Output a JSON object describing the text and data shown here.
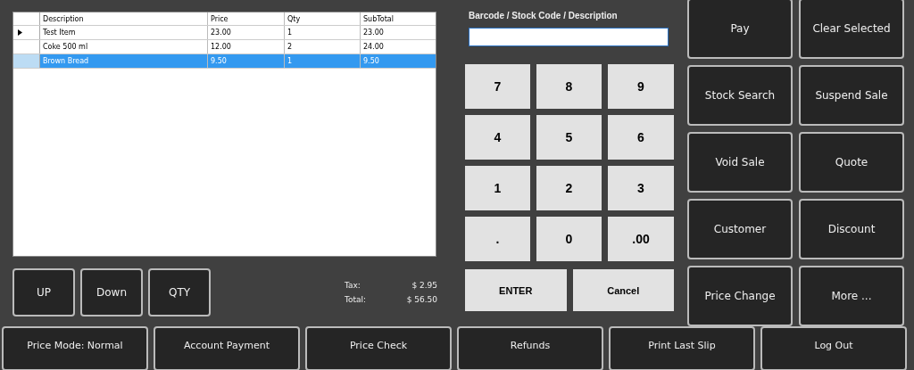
{
  "grid": {
    "columns": [
      "Description",
      "Price",
      "Qty",
      "SubTotal"
    ],
    "rows": [
      {
        "current": true,
        "selected": false,
        "cells": [
          "Test Item",
          "23.00",
          "1",
          "23.00"
        ]
      },
      {
        "current": false,
        "selected": false,
        "cells": [
          "Coke 500 ml",
          "12.00",
          "2",
          "24.00"
        ]
      },
      {
        "current": false,
        "selected": true,
        "cells": [
          "Brown Bread",
          "9.50",
          "1",
          "9.50"
        ]
      }
    ]
  },
  "nav_buttons": [
    "UP",
    "Down",
    "QTY"
  ],
  "totals": [
    {
      "label": "Tax:",
      "value": "$ 2.95"
    },
    {
      "label": "Total:",
      "value": "$ 56.50"
    }
  ],
  "search": {
    "label": "Barcode / Stock Code / Description"
  },
  "keypad": [
    "7",
    "8",
    "9",
    "4",
    "5",
    "6",
    "1",
    "2",
    "3",
    ".",
    "0",
    ".00"
  ],
  "keypad_actions": [
    "ENTER",
    "Cancel"
  ],
  "actions": [
    "Pay",
    "Clear Selected",
    "Stock Search",
    "Suspend Sale",
    "Void Sale",
    "Quote",
    "Customer",
    "Discount",
    "Price Change",
    "More ..."
  ],
  "bottom_bar": [
    "Price Mode: Normal",
    "Account Payment",
    "Price Check",
    "Refunds",
    "Print Last Slip",
    "Log Out"
  ]
}
